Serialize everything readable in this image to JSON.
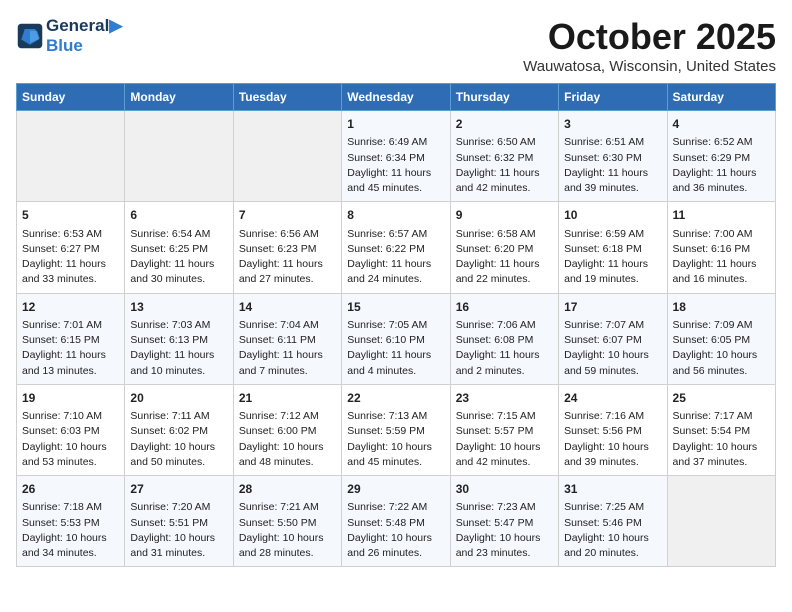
{
  "header": {
    "logo_line1": "General",
    "logo_line2": "Blue",
    "month": "October 2025",
    "location": "Wauwatosa, Wisconsin, United States"
  },
  "days_of_week": [
    "Sunday",
    "Monday",
    "Tuesday",
    "Wednesday",
    "Thursday",
    "Friday",
    "Saturday"
  ],
  "weeks": [
    [
      {
        "day": "",
        "info": ""
      },
      {
        "day": "",
        "info": ""
      },
      {
        "day": "",
        "info": ""
      },
      {
        "day": "1",
        "info": "Sunrise: 6:49 AM\nSunset: 6:34 PM\nDaylight: 11 hours\nand 45 minutes."
      },
      {
        "day": "2",
        "info": "Sunrise: 6:50 AM\nSunset: 6:32 PM\nDaylight: 11 hours\nand 42 minutes."
      },
      {
        "day": "3",
        "info": "Sunrise: 6:51 AM\nSunset: 6:30 PM\nDaylight: 11 hours\nand 39 minutes."
      },
      {
        "day": "4",
        "info": "Sunrise: 6:52 AM\nSunset: 6:29 PM\nDaylight: 11 hours\nand 36 minutes."
      }
    ],
    [
      {
        "day": "5",
        "info": "Sunrise: 6:53 AM\nSunset: 6:27 PM\nDaylight: 11 hours\nand 33 minutes."
      },
      {
        "day": "6",
        "info": "Sunrise: 6:54 AM\nSunset: 6:25 PM\nDaylight: 11 hours\nand 30 minutes."
      },
      {
        "day": "7",
        "info": "Sunrise: 6:56 AM\nSunset: 6:23 PM\nDaylight: 11 hours\nand 27 minutes."
      },
      {
        "day": "8",
        "info": "Sunrise: 6:57 AM\nSunset: 6:22 PM\nDaylight: 11 hours\nand 24 minutes."
      },
      {
        "day": "9",
        "info": "Sunrise: 6:58 AM\nSunset: 6:20 PM\nDaylight: 11 hours\nand 22 minutes."
      },
      {
        "day": "10",
        "info": "Sunrise: 6:59 AM\nSunset: 6:18 PM\nDaylight: 11 hours\nand 19 minutes."
      },
      {
        "day": "11",
        "info": "Sunrise: 7:00 AM\nSunset: 6:16 PM\nDaylight: 11 hours\nand 16 minutes."
      }
    ],
    [
      {
        "day": "12",
        "info": "Sunrise: 7:01 AM\nSunset: 6:15 PM\nDaylight: 11 hours\nand 13 minutes."
      },
      {
        "day": "13",
        "info": "Sunrise: 7:03 AM\nSunset: 6:13 PM\nDaylight: 11 hours\nand 10 minutes."
      },
      {
        "day": "14",
        "info": "Sunrise: 7:04 AM\nSunset: 6:11 PM\nDaylight: 11 hours\nand 7 minutes."
      },
      {
        "day": "15",
        "info": "Sunrise: 7:05 AM\nSunset: 6:10 PM\nDaylight: 11 hours\nand 4 minutes."
      },
      {
        "day": "16",
        "info": "Sunrise: 7:06 AM\nSunset: 6:08 PM\nDaylight: 11 hours\nand 2 minutes."
      },
      {
        "day": "17",
        "info": "Sunrise: 7:07 AM\nSunset: 6:07 PM\nDaylight: 10 hours\nand 59 minutes."
      },
      {
        "day": "18",
        "info": "Sunrise: 7:09 AM\nSunset: 6:05 PM\nDaylight: 10 hours\nand 56 minutes."
      }
    ],
    [
      {
        "day": "19",
        "info": "Sunrise: 7:10 AM\nSunset: 6:03 PM\nDaylight: 10 hours\nand 53 minutes."
      },
      {
        "day": "20",
        "info": "Sunrise: 7:11 AM\nSunset: 6:02 PM\nDaylight: 10 hours\nand 50 minutes."
      },
      {
        "day": "21",
        "info": "Sunrise: 7:12 AM\nSunset: 6:00 PM\nDaylight: 10 hours\nand 48 minutes."
      },
      {
        "day": "22",
        "info": "Sunrise: 7:13 AM\nSunset: 5:59 PM\nDaylight: 10 hours\nand 45 minutes."
      },
      {
        "day": "23",
        "info": "Sunrise: 7:15 AM\nSunset: 5:57 PM\nDaylight: 10 hours\nand 42 minutes."
      },
      {
        "day": "24",
        "info": "Sunrise: 7:16 AM\nSunset: 5:56 PM\nDaylight: 10 hours\nand 39 minutes."
      },
      {
        "day": "25",
        "info": "Sunrise: 7:17 AM\nSunset: 5:54 PM\nDaylight: 10 hours\nand 37 minutes."
      }
    ],
    [
      {
        "day": "26",
        "info": "Sunrise: 7:18 AM\nSunset: 5:53 PM\nDaylight: 10 hours\nand 34 minutes."
      },
      {
        "day": "27",
        "info": "Sunrise: 7:20 AM\nSunset: 5:51 PM\nDaylight: 10 hours\nand 31 minutes."
      },
      {
        "day": "28",
        "info": "Sunrise: 7:21 AM\nSunset: 5:50 PM\nDaylight: 10 hours\nand 28 minutes."
      },
      {
        "day": "29",
        "info": "Sunrise: 7:22 AM\nSunset: 5:48 PM\nDaylight: 10 hours\nand 26 minutes."
      },
      {
        "day": "30",
        "info": "Sunrise: 7:23 AM\nSunset: 5:47 PM\nDaylight: 10 hours\nand 23 minutes."
      },
      {
        "day": "31",
        "info": "Sunrise: 7:25 AM\nSunset: 5:46 PM\nDaylight: 10 hours\nand 20 minutes."
      },
      {
        "day": "",
        "info": ""
      }
    ]
  ]
}
